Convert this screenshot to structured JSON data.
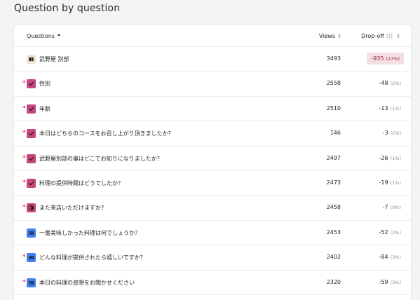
{
  "page": {
    "title": "Question by question"
  },
  "header": {
    "questions_label": "Questions",
    "views_label": "Views",
    "dropoff_label": "Drop-off",
    "dropoff_help": "(?)"
  },
  "rows": [
    {
      "required": false,
      "icon": "welcome-screen-icon",
      "text": "武野屋 別部",
      "views": "3493",
      "drop": "-935",
      "pct": "(27%)",
      "highlight": true
    },
    {
      "required": true,
      "icon": "checkbox-icon",
      "text": "性別",
      "views": "2558",
      "drop": "-48",
      "pct": "(2%)"
    },
    {
      "required": true,
      "icon": "checkbox-icon",
      "text": "年齢",
      "views": "2510",
      "drop": "-13",
      "pct": "(1%)"
    },
    {
      "required": true,
      "icon": "checkbox-icon",
      "text": "本日はどちらのコースをお召し上がり頂きましたか？",
      "views": "146",
      "drop": "-3",
      "pct": "(2%)"
    },
    {
      "required": true,
      "icon": "checkbox-icon",
      "text": "武野屋別部の事はどこでお知りになりましたか？",
      "views": "2497",
      "drop": "-26",
      "pct": "(1%)"
    },
    {
      "required": true,
      "icon": "checkbox-icon",
      "text": "料理の提供時間はどうでしたか？",
      "views": "2473",
      "drop": "-19",
      "pct": "(1%)"
    },
    {
      "required": true,
      "icon": "opinion-scale-icon",
      "text": "また来店いただけますか?",
      "views": "2458",
      "drop": "-7",
      "pct": "(0%)"
    },
    {
      "required": false,
      "icon": "long-text-icon",
      "text": "一番美味しかった料理は何でしょうか？",
      "views": "2453",
      "drop": "-52",
      "pct": "(2%)"
    },
    {
      "required": true,
      "icon": "long-text-icon",
      "text": "どんな料理が提供されたら嬉しいですか？",
      "views": "2402",
      "drop": "-84",
      "pct": "(3%)"
    },
    {
      "required": true,
      "icon": "long-text-icon",
      "text": "本日の料理の感想をお聞かせください",
      "views": "2320",
      "drop": "-59",
      "pct": "(3%)"
    }
  ]
}
